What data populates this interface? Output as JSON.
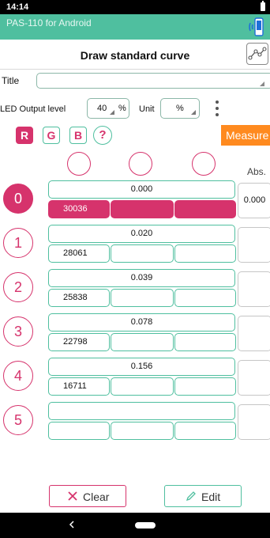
{
  "status_bar": {
    "time": "14:14"
  },
  "app": {
    "title": "PAS-110 for Android"
  },
  "toolbar": {
    "title": "Draw standard curve"
  },
  "form": {
    "title_label": "Title",
    "title_value": "",
    "led_label": "LED Output level",
    "led_value": "40",
    "led_unit": "%",
    "unit_label": "Unit",
    "unit_value": "%"
  },
  "channels": {
    "r": "R",
    "g": "G",
    "b": "B",
    "help": "?",
    "selected": "R"
  },
  "measure_label": "Measure",
  "abs_header": "Abs.",
  "rows": [
    {
      "index": "0",
      "conc": "0.000",
      "r": "30036",
      "g": "",
      "b": "",
      "abs": "0.000",
      "active": true
    },
    {
      "index": "1",
      "conc": "0.020",
      "r": "28061",
      "g": "",
      "b": "",
      "abs": "",
      "active": false
    },
    {
      "index": "2",
      "conc": "0.039",
      "r": "25838",
      "g": "",
      "b": "",
      "abs": "",
      "active": false
    },
    {
      "index": "3",
      "conc": "0.078",
      "r": "22798",
      "g": "",
      "b": "",
      "abs": "",
      "active": false
    },
    {
      "index": "4",
      "conc": "0.156",
      "r": "16711",
      "g": "",
      "b": "",
      "abs": "",
      "active": false
    },
    {
      "index": "5",
      "conc": "",
      "r": "",
      "g": "",
      "b": "",
      "abs": "",
      "active": false
    }
  ],
  "buttons": {
    "clear": "Clear",
    "edit": "Edit"
  },
  "colors": {
    "accent_pink": "#d6336c",
    "accent_green": "#4fbf9f",
    "measure_orange": "#ff8a1f"
  },
  "icons": [
    "bluetooth-device-icon",
    "standard-curve-icon",
    "more-vert-icon",
    "close-icon",
    "pencil-icon",
    "back-icon",
    "home-icon"
  ]
}
